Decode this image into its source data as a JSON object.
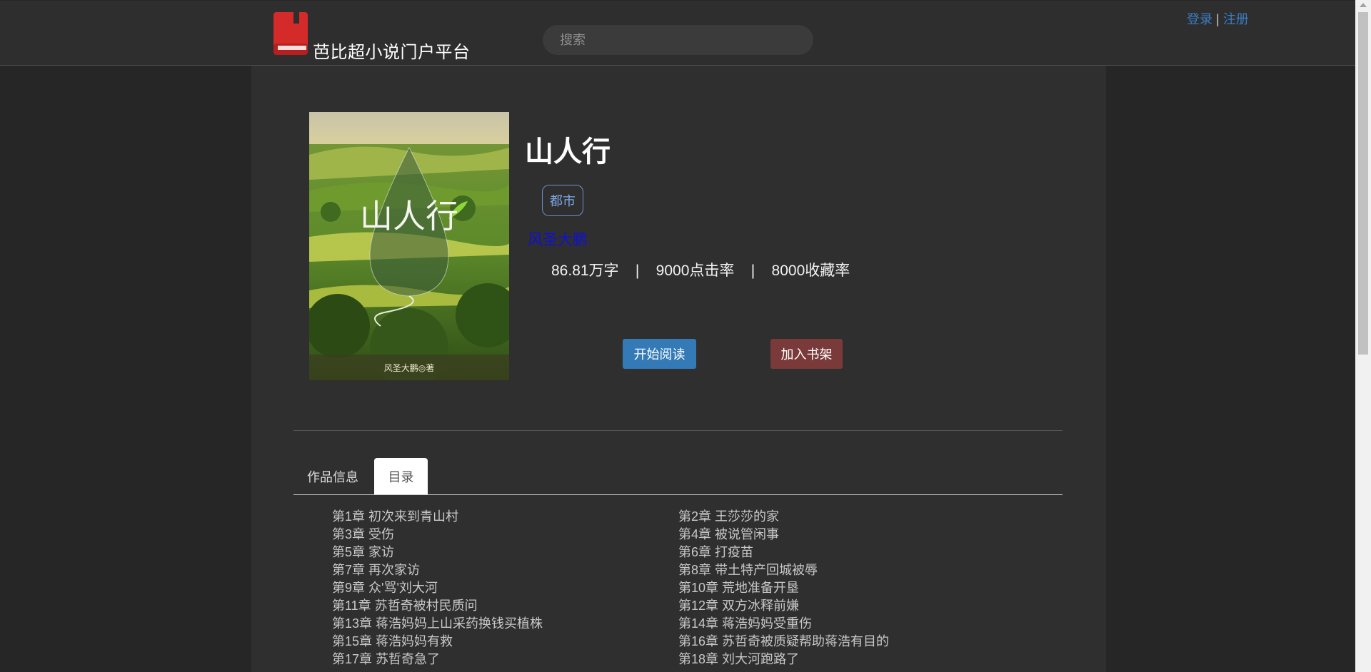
{
  "header": {
    "brand": "芭比超小说门户平台",
    "search_placeholder": "搜索",
    "login": "登录",
    "separator": "|",
    "register": "注册"
  },
  "book": {
    "title": "山人行",
    "tag": "都市",
    "author": "风圣大鹏",
    "stats": "86.81万字    |    9000点击率    |    8000收藏率",
    "start_reading": "开始阅读",
    "add_shelf": "加入书架",
    "cover_title": "山人行",
    "cover_author": "风圣大鹏◎著"
  },
  "tabs": [
    {
      "label": "作品信息",
      "active": false
    },
    {
      "label": "目录",
      "active": true
    }
  ],
  "chapters": [
    "第1章 初次来到青山村",
    "第2章 王莎莎的家",
    "第3章 受伤",
    "第4章 被说管闲事",
    "第5章 家访",
    "第6章 打疫苗",
    "第7章 再次家访",
    "第8章 带土特产回城被辱",
    "第9章 众'骂'刘大河",
    "第10章 荒地准备开垦",
    "第11章 苏哲奇被村民质问",
    "第12章 双方冰释前嫌",
    "第13章 蒋浩妈妈上山采药换钱买植株",
    "第14章 蒋浩妈妈受重伤",
    "第15章 蒋浩妈妈有救",
    "第16章 苏哲奇被质疑帮助蒋浩有目的",
    "第17章 苏哲奇急了",
    "第18章 刘大河跑路了"
  ],
  "colors": {
    "accent": "#337ab7",
    "shelf": "#7a3a3a",
    "link": "#3a7dc4",
    "author": "#1010d8",
    "logo_red": "#d42a2a"
  }
}
